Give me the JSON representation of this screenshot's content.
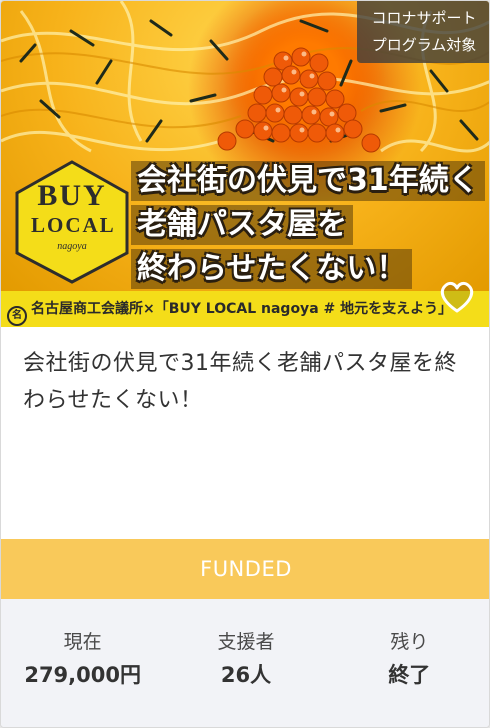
{
  "card": {
    "corner_badge": {
      "line1": "コロナサポート",
      "line2": "プログラム対象"
    },
    "logo": {
      "line1": "BUY",
      "line2": "LOCAL",
      "line3": "nagoya"
    },
    "banner": {
      "line1": "会社街の伏見で31年続く",
      "line2": "老舗パスタ屋を",
      "line3": "終わらせたくない！"
    },
    "strip_text": "名古屋商工会議所×「BUY LOCAL nagoya # 地元を支えよう」",
    "favorite_icon": "heart-outline-icon",
    "title": "会社街の伏見で31年続く老舗パスタ屋を終わらせたくない！",
    "status_label": "FUNDED",
    "stats": [
      {
        "label": "現在",
        "value": "279,000円"
      },
      {
        "label": "支援者",
        "value": "26人"
      },
      {
        "label": "残り",
        "value": "終了"
      }
    ]
  },
  "colors": {
    "funded_band": "#f9c95a",
    "strip": "#f4dd19",
    "stats_bg": "#f2f3f7"
  }
}
